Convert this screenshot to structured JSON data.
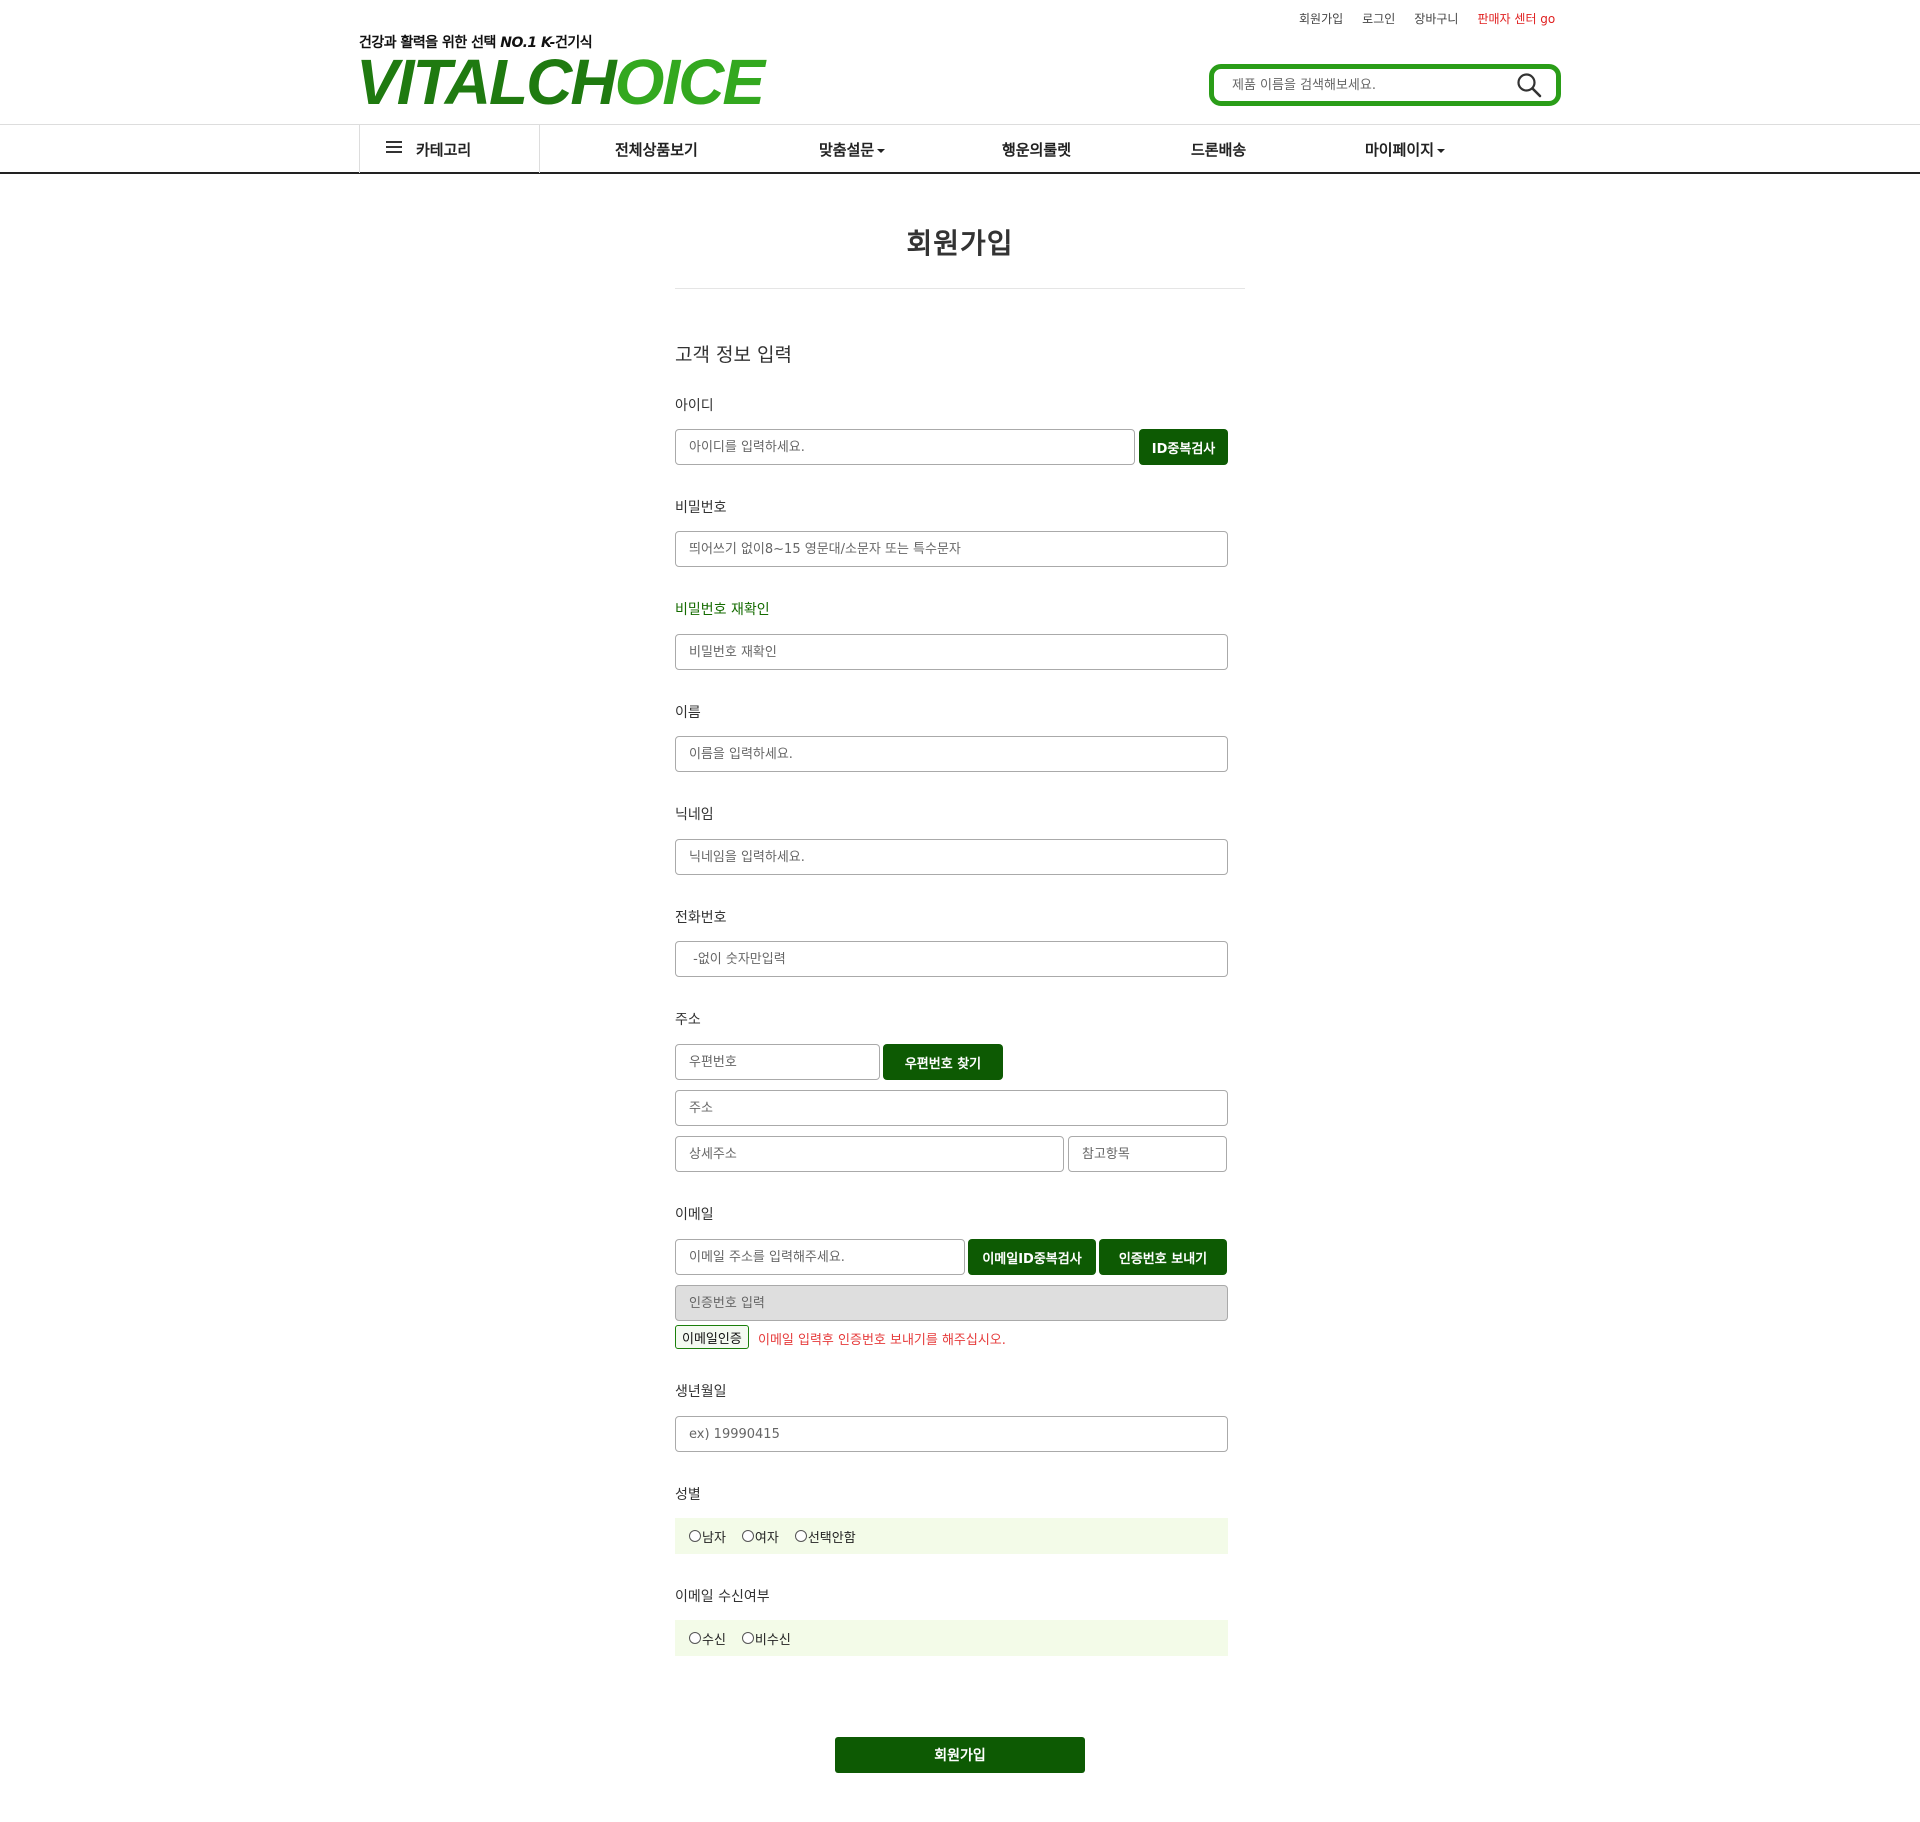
{
  "header": {
    "util_links": [
      "회원가입",
      "로그인",
      "장바구니"
    ],
    "seller_link": "판매자 센터 go",
    "tagline": "건강과 활력을 위한 선택",
    "tagline_brand": "NO.1 K-",
    "tagline_tail": "건기식",
    "logo_left": "VITALCH",
    "logo_mid": "O",
    "logo_right": "ICE",
    "search_placeholder": "제품 이름을 검색해보세요."
  },
  "nav": {
    "category": "카테고리",
    "items": [
      "전체상품보기",
      "맞춤설문",
      "행운의룰렛",
      "드론배송",
      "마이페이지"
    ]
  },
  "page": {
    "title": "회원가입",
    "section_title": "고객 정보 입력"
  },
  "form": {
    "id": {
      "label": "아이디",
      "placeholder": "아이디를 입력하세요.",
      "button": "ID중복검사"
    },
    "password": {
      "label": "비밀번호",
      "placeholder": "띄어쓰기 없이8~15 영문대/소문자 또는 특수문자"
    },
    "password_confirm": {
      "label": "비밀번호 재확인",
      "placeholder": "비밀번호 재확인"
    },
    "name": {
      "label": "이름",
      "placeholder": "이름을 입력하세요."
    },
    "nickname": {
      "label": "닉네임",
      "placeholder": "닉네임을 입력하세요."
    },
    "phone": {
      "label": "전화번호",
      "placeholder": " -없이 숫자만입력"
    },
    "address": {
      "label": "주소",
      "zip_placeholder": "우편번호",
      "zip_button": "우편번호 찾기",
      "address_placeholder": "주소",
      "detail_placeholder": "상세주소",
      "extra_placeholder": "참고항목"
    },
    "email": {
      "label": "이메일",
      "placeholder": "이메일 주소를 입력해주세요.",
      "dup_button": "이메일ID중복검사",
      "send_button": "인증번호 보내기",
      "code_placeholder": "인증번호 입력",
      "verify_button": "이메일인증",
      "warning": "이메일 입력후 인증번호 보내기를 해주십시오."
    },
    "birth": {
      "label": "생년월일",
      "placeholder": "ex) 19990415"
    },
    "gender": {
      "label": "성별",
      "options": [
        "남자",
        "여자",
        "선택안함"
      ]
    },
    "email_consent": {
      "label": "이메일 수신여부",
      "options": [
        "수신",
        "비수신"
      ]
    },
    "submit": "회원가입"
  },
  "colors": {
    "brand_green": "#0d5a03",
    "logo_green": "#2a9d18",
    "warning_red": "#e63b3b",
    "radio_bg": "#f3fbe8"
  }
}
